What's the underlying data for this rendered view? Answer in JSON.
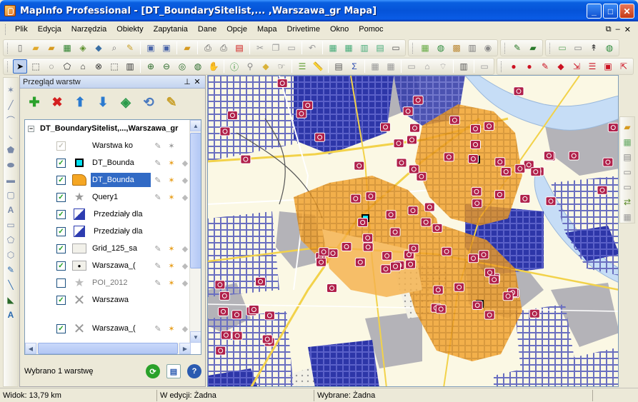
{
  "window": {
    "title": "MapInfo Professional - [DT_BoundarySitelist,... ,Warszawa_gr Mapa]",
    "buttons": [
      "minimize",
      "maximize",
      "close"
    ]
  },
  "menu": {
    "items": [
      "Plik",
      "Edycja",
      "Narzędzia",
      "Obiekty",
      "Zapytania",
      "Dane",
      "Opcje",
      "Mapa",
      "Drivetime",
      "Okno",
      "Pomoc"
    ],
    "right_icons": [
      "restore-child",
      "minimize-child",
      "close-child"
    ]
  },
  "layer_panel": {
    "title": "Przegląd warstw",
    "root_label": "DT_BoundarySitelist,...,Warszawa_gr",
    "layers": [
      {
        "name": "Warstwa ko",
        "checked": true,
        "enabled": false,
        "icon": "cosmetic-layer-icon"
      },
      {
        "name": "DT_Bounda",
        "checked": true,
        "enabled": true,
        "icon": "cyan-point-icon"
      },
      {
        "name": "DT_Bounda",
        "checked": true,
        "enabled": true,
        "selected": true,
        "icon": "orange-region-icon"
      },
      {
        "name": "Query1",
        "checked": true,
        "enabled": true,
        "icon": "star-point-icon"
      },
      {
        "name": "Przedziały dla",
        "checked": true,
        "enabled": true,
        "icon": "thematic-map-icon"
      },
      {
        "name": "Przedziały dla",
        "checked": true,
        "enabled": true,
        "icon": "thematic-map-icon"
      },
      {
        "name": "Grid_125_sa",
        "checked": true,
        "enabled": true,
        "icon": "grid-region-icon"
      },
      {
        "name": "Warszawa_(",
        "checked": true,
        "enabled": true,
        "icon": "dot-region-icon"
      },
      {
        "name": "POI_2012",
        "checked": false,
        "enabled": true,
        "dim": true,
        "icon": "star-point-icon"
      },
      {
        "name": "Warszawa",
        "checked": true,
        "enabled": true,
        "icon": "cross-line-icon"
      },
      {
        "name": "Warszawa_(",
        "checked": true,
        "enabled": true,
        "icon": "cross-line-icon"
      }
    ],
    "status_text": "Wybrano 1 warstwę"
  },
  "statusbar": {
    "zoom": "Widok: 13,79 km",
    "editing": "W edycji: Żadna",
    "selected": "Wybrane: Żadna"
  },
  "colors": {
    "titlebar": "#0553D8",
    "drivetime": "#F5A623",
    "grid": "#3A3FB0",
    "river": "#C6DDF6"
  }
}
